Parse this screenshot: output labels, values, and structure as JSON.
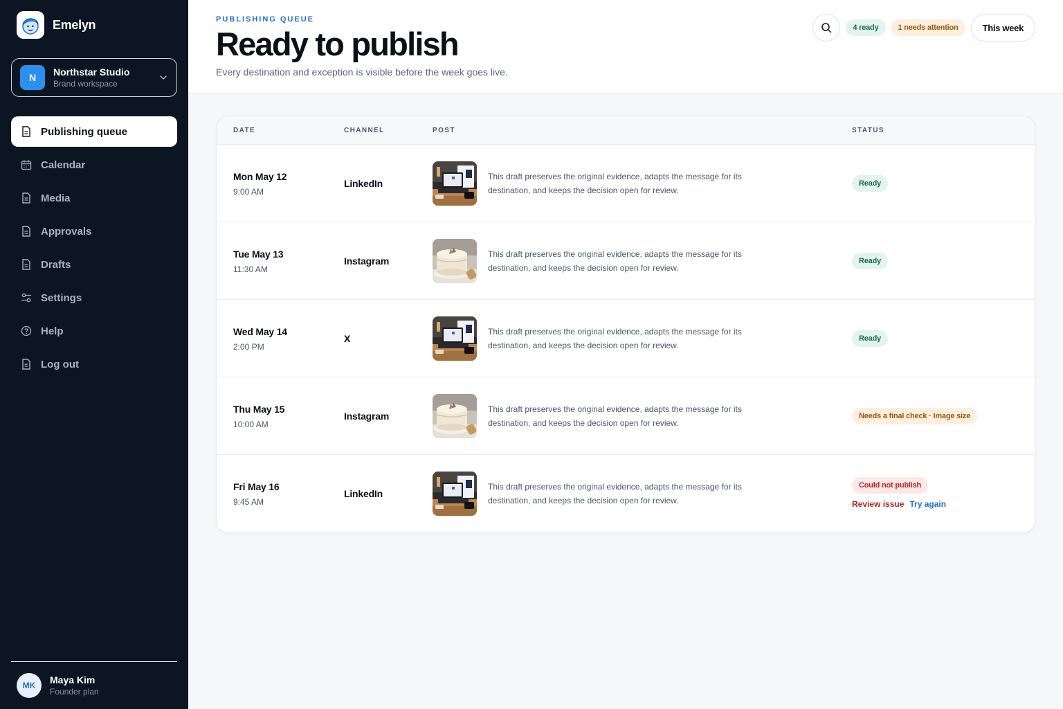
{
  "app": {
    "name": "Emelyn"
  },
  "workspace": {
    "initial": "N",
    "name": "Northstar Studio",
    "subtitle": "Brand workspace"
  },
  "nav": [
    {
      "label": "Publishing queue",
      "icon": "document-icon",
      "active": true
    },
    {
      "label": "Calendar",
      "icon": "calendar-icon",
      "active": false
    },
    {
      "label": "Media",
      "icon": "document-icon",
      "active": false
    },
    {
      "label": "Approvals",
      "icon": "document-icon",
      "active": false
    },
    {
      "label": "Drafts",
      "icon": "document-icon",
      "active": false
    },
    {
      "label": "Settings",
      "icon": "sliders-icon",
      "active": false
    },
    {
      "label": "Help",
      "icon": "help-circle-icon",
      "active": false
    },
    {
      "label": "Log out",
      "icon": "document-icon",
      "active": false
    }
  ],
  "user": {
    "initials": "MK",
    "name": "Maya Kim",
    "plan": "Founder plan"
  },
  "header": {
    "eyebrow": "PUBLISHING QUEUE",
    "title": "Ready to publish",
    "subtitle": "Every destination and exception is visible before the week goes live.",
    "ready_pill": "4 ready",
    "attention_pill": "1 needs attention",
    "range_button": "This week"
  },
  "table": {
    "columns": {
      "date": "DATE",
      "channel": "CHANNEL",
      "post": "POST",
      "status": "STATUS"
    },
    "rows": [
      {
        "date": "Mon May 12",
        "time": "9:00 AM",
        "channel": "LinkedIn",
        "thumb": "laptop-desk",
        "text": "This draft preserves the original evidence, adapts the message for its destination, and keeps the decision open for review.",
        "status": "Ready",
        "status_kind": "ready"
      },
      {
        "date": "Tue May 13",
        "time": "11:30 AM",
        "channel": "Instagram",
        "thumb": "cake",
        "text": "This draft preserves the original evidence, adapts the message for its destination, and keeps the decision open for review.",
        "status": "Ready",
        "status_kind": "ready"
      },
      {
        "date": "Wed May 14",
        "time": "2:00 PM",
        "channel": "X",
        "thumb": "laptop-desk",
        "text": "This draft preserves the original evidence, adapts the message for its destination, and keeps the decision open for review.",
        "status": "Ready",
        "status_kind": "ready"
      },
      {
        "date": "Thu May 15",
        "time": "10:00 AM",
        "channel": "Instagram",
        "thumb": "cake",
        "text": "This draft preserves the original evidence, adapts the message for its destination, and keeps the decision open for review.",
        "status": "Needs a final check · Image size",
        "status_kind": "check"
      },
      {
        "date": "Fri May 16",
        "time": "9:45 AM",
        "channel": "LinkedIn",
        "thumb": "laptop-desk",
        "text": "This draft preserves the original evidence, adapts the message for its destination, and keeps the decision open for review.",
        "status": "Could not publish",
        "status_kind": "fail",
        "actions": {
          "review": "Review issue",
          "retry": "Try again"
        }
      }
    ]
  },
  "colors": {
    "sidebar": "#0b1622",
    "accent": "#1f6fd1",
    "ready": "#1c6b54",
    "attention": "#9a5612",
    "error": "#b3261e"
  }
}
